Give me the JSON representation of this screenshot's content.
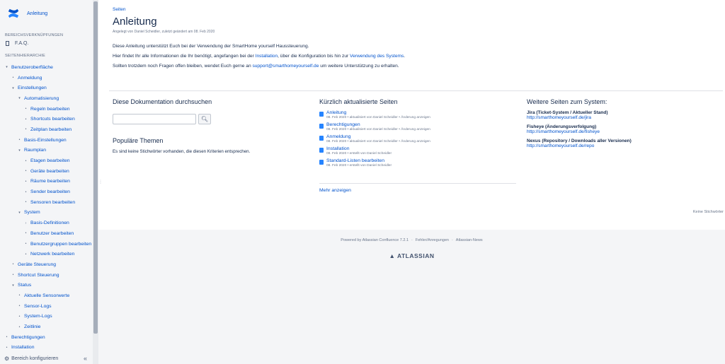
{
  "sidebar": {
    "space_name": "Anleitung",
    "shortcuts_label": "BEREICHSVERKNÜPFUNGEN",
    "shortcut_item": "F.A.Q.",
    "hierarchy_label": "SEITENHIERARCHIE",
    "tree": [
      {
        "label": "Benutzeroberfläche",
        "level": 0,
        "toggle": "▾"
      },
      {
        "label": "Anmeldung",
        "level": 1,
        "toggle": "•"
      },
      {
        "label": "Einstellungen",
        "level": 1,
        "toggle": "▾"
      },
      {
        "label": "Automatisierung",
        "level": 2,
        "toggle": "▾"
      },
      {
        "label": "Regeln bearbeiten",
        "level": 3,
        "toggle": "•"
      },
      {
        "label": "Shortcuts bearbeiten",
        "level": 3,
        "toggle": "•"
      },
      {
        "label": "Zeitplan bearbeiten",
        "level": 3,
        "toggle": "•"
      },
      {
        "label": "Basis-Einstellungen",
        "level": 2,
        "toggle": "•"
      },
      {
        "label": "Raumplan",
        "level": 2,
        "toggle": "▾"
      },
      {
        "label": "Etagen bearbeiten",
        "level": 3,
        "toggle": "•"
      },
      {
        "label": "Geräte bearbeiten",
        "level": 3,
        "toggle": "•"
      },
      {
        "label": "Räume bearbeiten",
        "level": 3,
        "toggle": "•"
      },
      {
        "label": "Sender bearbeiten",
        "level": 3,
        "toggle": "•"
      },
      {
        "label": "Sensoren bearbeiten",
        "level": 3,
        "toggle": "•"
      },
      {
        "label": "System",
        "level": 2,
        "toggle": "▾"
      },
      {
        "label": "Basis-Definitionen",
        "level": 3,
        "toggle": "›"
      },
      {
        "label": "Benutzer bearbeiten",
        "level": 3,
        "toggle": "•"
      },
      {
        "label": "Benutzergruppen bearbeiten",
        "level": 3,
        "toggle": "•"
      },
      {
        "label": "Netzwerk bearbeiten",
        "level": 3,
        "toggle": "•"
      },
      {
        "label": "Geräte Steuerung",
        "level": 1,
        "toggle": "•"
      },
      {
        "label": "Shortcut Steuerung",
        "level": 1,
        "toggle": "•"
      },
      {
        "label": "Status",
        "level": 1,
        "toggle": "▾"
      },
      {
        "label": "Aktuelle Sensorwerte",
        "level": 2,
        "toggle": "•"
      },
      {
        "label": "Sensor-Logs",
        "level": 2,
        "toggle": "•"
      },
      {
        "label": "System-Logs",
        "level": 2,
        "toggle": "•"
      },
      {
        "label": "Zeitlinie",
        "level": 2,
        "toggle": "•"
      },
      {
        "label": "Berechtigungen",
        "level": 0,
        "toggle": "•"
      },
      {
        "label": "Installation",
        "level": 0,
        "toggle": "•"
      }
    ],
    "configure_label": "Bereich konfigurieren",
    "collapse_glyph": "«"
  },
  "page": {
    "breadcrumb": "Seiten",
    "title": "Anleitung",
    "byline": "Angelegt von Daniel Scheidler, zuletzt geändert am 08. Feb 2020",
    "p1": "Diese Anleitung unterstützt Euch bei der Verwendung der SmartHome yourself Haussteuerung.",
    "p2_a": "Hier findet Ihr alle Informationen die Ihr benötigt, angefangen bei der ",
    "p2_link1": "Installation",
    "p2_b": ", über die Konfiguration bis hin zur ",
    "p2_link2": "Verwendung des Systems",
    "p2_c": ".",
    "p3_a": "Sollten trotzdem noch Fragen offen bleiben, wendet Euch gerne an ",
    "p3_link": "support@smarthomeyourself.de",
    "p3_b": " um weitere Unterstützung zu erhalten."
  },
  "search": {
    "title": "Diese Dokumentation durchsuchen",
    "value": "",
    "button_icon": "search-icon"
  },
  "popular": {
    "title": "Populäre Themen",
    "empty": "Es sind keine Stichwörter vorhanden, die diesen Kriterien entsprechen."
  },
  "recent": {
    "title": "Kürzlich aktualisierte Seiten",
    "items": [
      {
        "title": "Anleitung",
        "meta": "08. Feb 2020 • aktualisiert von Daniel Scheidler • Änderung anzeigen"
      },
      {
        "title": "Berechtigungen",
        "meta": "08. Feb 2020 • aktualisiert von Daniel Scheidler • Änderung anzeigen"
      },
      {
        "title": "Anmeldung",
        "meta": "08. Feb 2020 • aktualisiert von Daniel Scheidler • Änderung anzeigen"
      },
      {
        "title": "Installation",
        "meta": "08. Feb 2020 • erstellt von Daniel Scheidler"
      },
      {
        "title": "Standard-Listen bearbeiten",
        "meta": "08. Feb 2020 • erstellt von Daniel Scheidler"
      }
    ],
    "more": "Mehr anzeigen"
  },
  "related": {
    "title": "Weitere Seiten zum System:",
    "items": [
      {
        "title": "Jira (Ticket-System / Aktueller Stand)",
        "link": "http://smarthomeyourself.de/jira"
      },
      {
        "title": "Fisheye (Änderungsverfolgung)",
        "link": "http://smarthomeyourself.de/fisheye"
      },
      {
        "title": "Nexus (Repository / Downloads aller Versionen)",
        "link": "http://smarthomeyourself.de/repo"
      }
    ]
  },
  "labels_text": "Keine Stichwörter",
  "footer": {
    "powered": "Powered by Atlassian Confluence 7.2.1",
    "report": "Fehler/Anregungen",
    "news": "Atlassian-News",
    "brand": "ATLASSIAN"
  }
}
